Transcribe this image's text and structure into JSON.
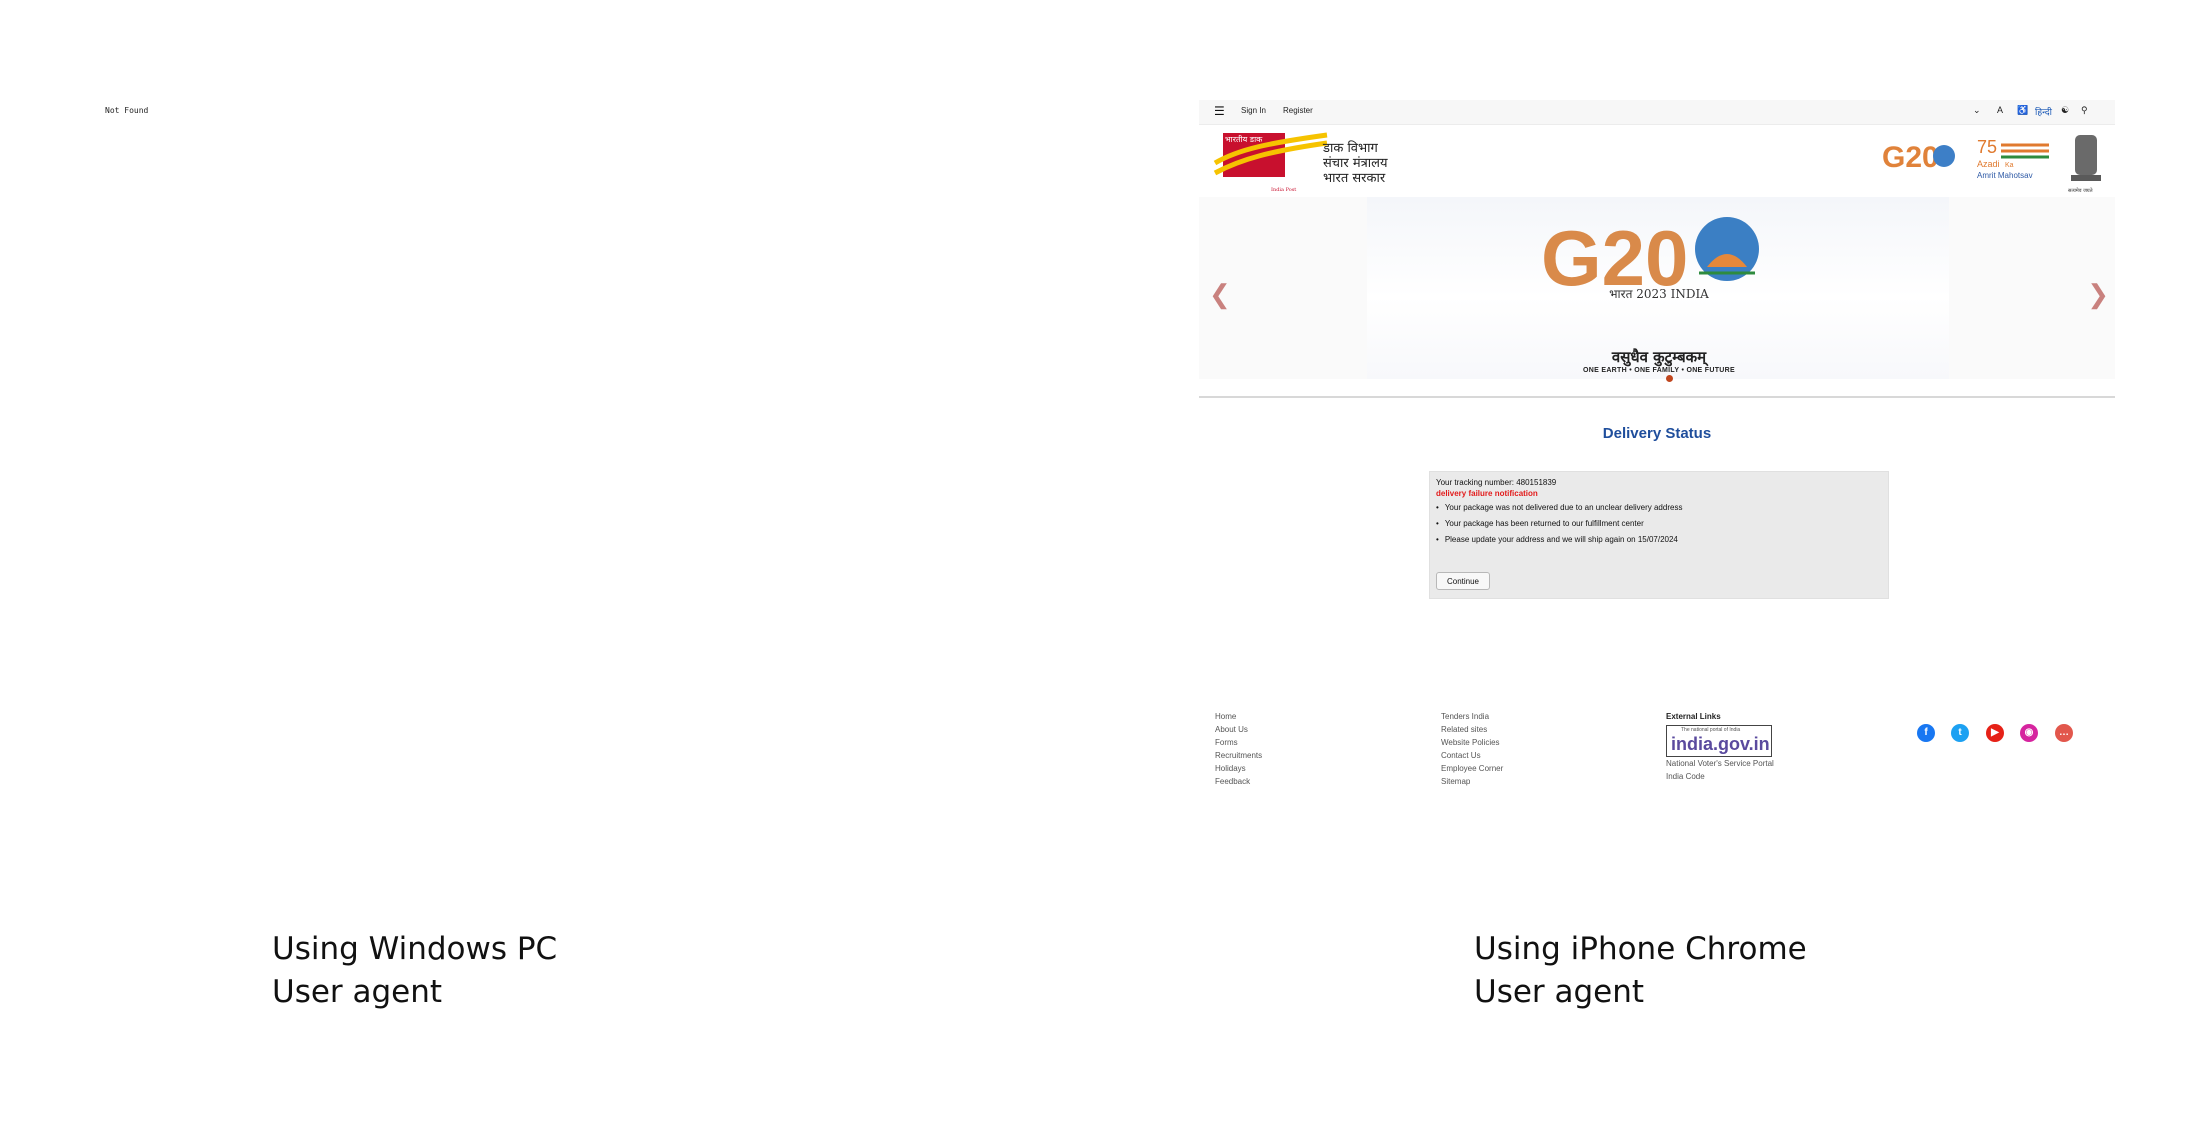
{
  "left_panel": {
    "page_text": "Not Found",
    "caption_line1": "Using Windows PC",
    "caption_line2": "User agent"
  },
  "right_panel": {
    "caption_line1": "Using iPhone Chrome",
    "caption_line2": "User agent",
    "topbar": {
      "menu_icon": "hamburger-icon",
      "sign_in": "Sign In",
      "register": "Register",
      "hindi": "हिन्दी"
    },
    "header": {
      "logo_text": "भारतीय डाक",
      "logo_subtext": "India Post",
      "dept_line1": "डाक विभाग",
      "dept_line2": "संचार मंत्रालय",
      "dept_line3": "भारत सरकार",
      "g20_small_label": "G20",
      "azadi_line1": "Azadi",
      "azadi_line2": "Ka",
      "azadi_line3": "Amrit Mahotsav",
      "emblem_caption": "सत्यमेव जयते"
    },
    "banner": {
      "g20": "G20",
      "g20_sub": "भारत 2023 INDIA",
      "motto": "वसुधैव कुटुम्बकम्",
      "tagline": "ONE EARTH • ONE FAMILY • ONE FUTURE"
    },
    "delivery": {
      "title": "Delivery Status",
      "tracking": "Your tracking number: 480151839",
      "failure": "delivery failure notification",
      "items": [
        "Your package was not delivered due to an unclear delivery address",
        "Your package has been returned to our fulfillment center",
        "Please update your address and we will ship again on 15/07/2024"
      ],
      "button": "Continue"
    },
    "footer": {
      "col1": [
        "Home",
        "About Us",
        "Forms",
        "Recruitments",
        "Holidays",
        "Feedback"
      ],
      "col2": [
        "Tenders India",
        "Related sites",
        "Website Policies",
        "Contact Us",
        "Employee Corner",
        "Sitemap"
      ],
      "external_heading": "External Links",
      "india_gov_small": "The national portal of India",
      "india_gov": "india.gov.in",
      "external_links": [
        "National Voter's Service Portal",
        "India Code"
      ]
    },
    "colors": {
      "title_blue": "#1f4e9c",
      "failure_red": "#e21b1b",
      "facebook": "#1877f2",
      "twitter": "#1da1f2",
      "youtube": "#e62117",
      "instagram": "#d6249f",
      "chat": "#e2574c"
    }
  }
}
